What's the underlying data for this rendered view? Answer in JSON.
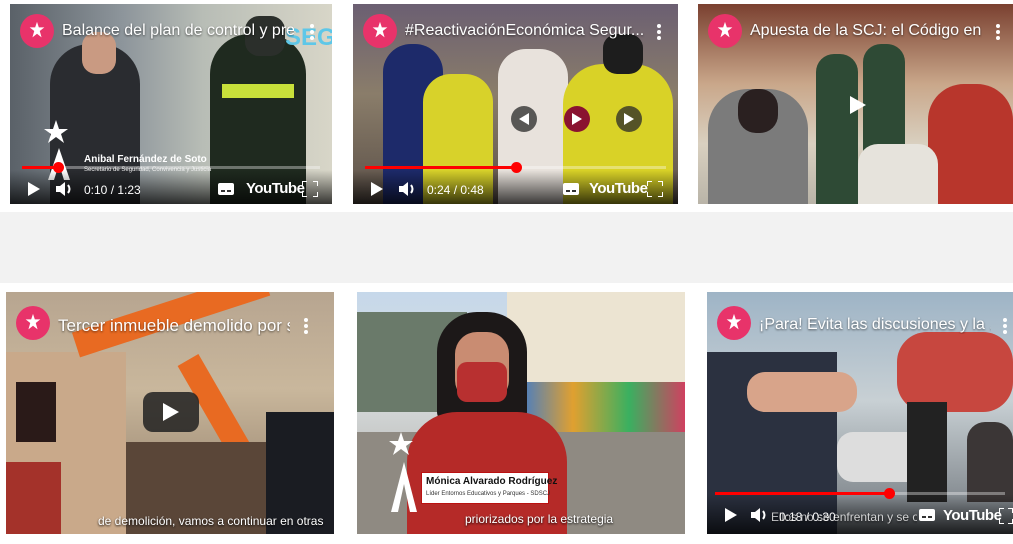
{
  "colors": {
    "brand_pink": "#e8336a",
    "youtube_red": "#ff0000",
    "page_bg": "#f2f2f2"
  },
  "videos": [
    {
      "title": "Balance del plan de control y pre...",
      "time": "0:10 / 1:23",
      "progress": 0.12,
      "brand": "YouTube",
      "lower_third_name": "Anibal Fernández de Soto",
      "lower_third_role": "Secretario de Seguridad, Convivencia y Justicia"
    },
    {
      "title": "#ReactivaciónEconómica Segur...",
      "time": "0:24 / 0:48",
      "progress": 0.5,
      "brand": "YouTube"
    },
    {
      "title": "Apuesta de la SCJ: el Código en ..."
    },
    {
      "title": "Tercer inmueble demolido por s...",
      "subtitle": "de demolición, vamos a continuar en otras"
    },
    {
      "lower_third_name": "Mónica Alvarado Rodríguez",
      "lower_third_role": "Líder Entornos Educativos y Parques - SDSCJ",
      "subtitle": "priorizados por la estrategia"
    },
    {
      "title": "¡Para! Evita las discusiones y la ...",
      "time": "0:18 / 0:30",
      "progress": 0.6,
      "brand": "YouTube",
      "subtitle": "Ellos no se enfrentan y se ofrecen disculpas"
    }
  ]
}
